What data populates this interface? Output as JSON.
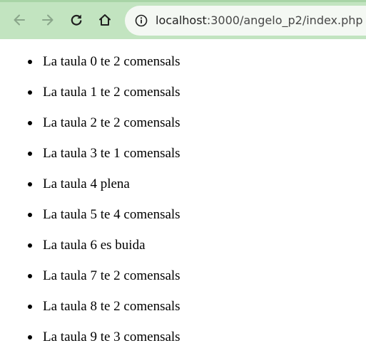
{
  "browser": {
    "url_host": "localhost",
    "url_path": ":3000/angelo_p2/index.php",
    "icons": {
      "back": "arrow-left-icon",
      "forward": "arrow-right-icon",
      "reload": "reload-icon",
      "home": "home-icon",
      "site_info": "info-icon"
    },
    "colors": {
      "toolbar": "#c2e4c0",
      "address_bar": "#f4f8f3"
    }
  },
  "page": {
    "items": [
      {
        "text": "La taula 0 te 2 comensals"
      },
      {
        "text": "La taula 1 te 2 comensals"
      },
      {
        "text": "La taula 2 te 2 comensals"
      },
      {
        "text": "La taula 3 te 1 comensals"
      },
      {
        "text": "La taula 4 plena"
      },
      {
        "text": "La taula 5 te 4 comensals"
      },
      {
        "text": "La taula 6 es buida"
      },
      {
        "text": "La taula 7 te 2 comensals"
      },
      {
        "text": "La taula 8 te 2 comensals"
      },
      {
        "text": "La taula 9 te 3 comensals"
      }
    ]
  }
}
